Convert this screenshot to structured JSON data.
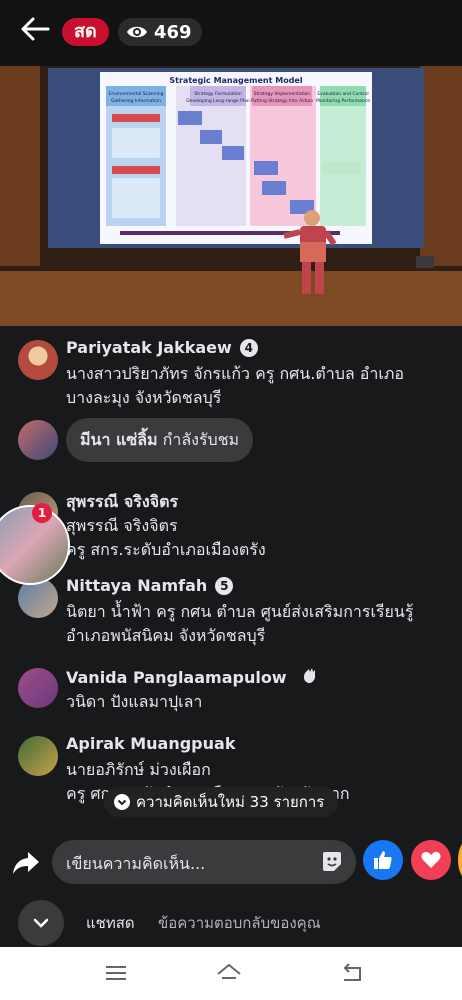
{
  "header": {
    "live_label": "สด",
    "viewer_count": "469"
  },
  "video": {
    "slide_title": "Strategic Management Model",
    "columns": [
      {
        "title": "Environmental Scanning",
        "sub": "Gathering Information"
      },
      {
        "title": "Strategy Formulation",
        "sub": "Developing Long-range Plan"
      },
      {
        "title": "Strategy Implementation",
        "sub": "Putting Strategy Into Action"
      },
      {
        "title": "Evaluation and Control",
        "sub": "Monitoring Performance"
      }
    ]
  },
  "comments": [
    {
      "name": "Pariyatak Jakkaew",
      "badge": "4",
      "text": "นางสาวปริยาภัทร จักรแก้ว ครู กศน.ตำบล อำเภอบางละมุง จังหวัดชลบุรี"
    },
    {
      "join_name": "มีนา แซ่ลิ้ม",
      "join_text": "กำลังรับชม"
    },
    {
      "name": "สุพรรณี จริงจิตร",
      "text": "สุพรรณี จริงจิตร\nครู สกร.ระดับอำเภอเมืองตรัง"
    },
    {
      "name": "Nittaya Namfah",
      "badge": "5",
      "text": "นิตยา น้ำฟ้า ครู กศน ตำบล ศูนย์ส่งเสริมการเรียนรู้อำเภอพนัสนิคม จังหวัดชลบุรี"
    },
    {
      "name": "Vanida Panglaamapulow",
      "text": "วนิดา ปังแลมาปุเลา"
    },
    {
      "name": "Apirak Muangpuak",
      "text": "นายอภิรักษ์ ม่วงเผือก\nครู ศกร.ระดับอำเภอเมืองตาก จังหวัดตาก"
    }
  ],
  "notification_count": "1",
  "new_comments_pill": "ความคิดเห็นใหม่ 33 รายการ",
  "composer": {
    "placeholder": "เขียนความคิดเห็น..."
  },
  "footer": {
    "chat_label": "แชทสด",
    "reply_label": "ข้อความตอบกลับของคุณ"
  },
  "colors": {
    "live_red": "#c8102e",
    "like_blue": "#1877f2",
    "love_red": "#f33e58",
    "background": "#18191a"
  },
  "icons": [
    "back-arrow-icon",
    "eye-icon",
    "share-icon",
    "sticker-icon",
    "like-icon",
    "love-icon",
    "chevron-down-icon",
    "menu-icon",
    "home-icon",
    "back-nav-icon"
  ]
}
